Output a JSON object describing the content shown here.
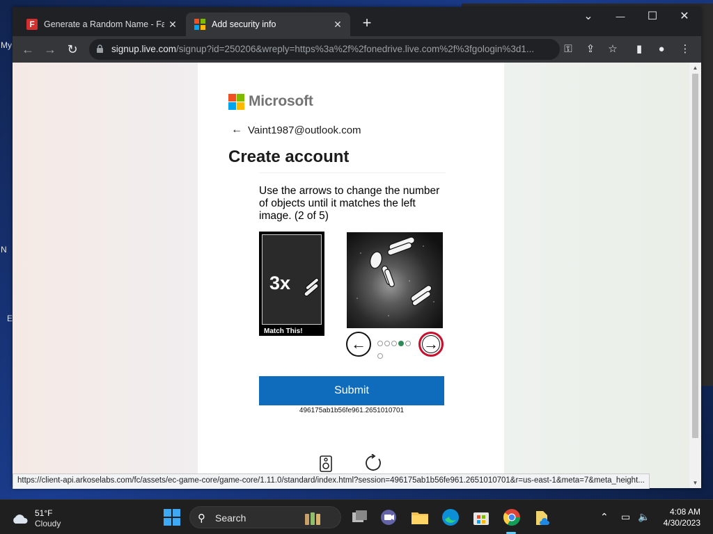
{
  "desktop": {
    "fragments": [
      "My",
      "N",
      "E"
    ]
  },
  "browser": {
    "tabs": [
      {
        "title": "Generate a Random Name - Fake",
        "close": "✕"
      },
      {
        "title": "Add security info",
        "close": "✕"
      }
    ],
    "new_tab": "+",
    "window_controls": {
      "chevron": "⌄",
      "minimize": "—",
      "maximize": "☐",
      "close": "✕"
    },
    "url_host": "signup.live.com",
    "url_rest": "/signup?id=250206&wreply=https%3a%2f%2fonedrive.live.com%2f%3fgologin%3d1...",
    "status_url": "https://client-api.arkoselabs.com/fc/assets/ec-game-core/game-core/1.11.0/standard/index.html?session=496175ab1b56fe961.2651010701&r=us-east-1&meta=7&meta_height..."
  },
  "page": {
    "brand": "Microsoft",
    "back_arrow": "←",
    "email": "Vaint1987@outlook.com",
    "heading": "Create account",
    "prompt": "Use the arrows to change the number of objects until it matches the left image. (2 of 5)",
    "match_count": "3x",
    "match_caption": "Match This!",
    "left_arrow": "←",
    "right_arrow": "→",
    "dots_total": 6,
    "dots_active_index": 3,
    "submit_label": "Submit",
    "session_id": "496175ab1b56fe961.2651010701"
  },
  "colors": {
    "ms_red": "#f25022",
    "ms_green": "#7fba00",
    "ms_blue": "#00a4ef",
    "ms_yellow": "#ffb900",
    "submit_blue": "#0f6cbd",
    "right_arrow_ring": "#c8102e"
  },
  "taskbar": {
    "temperature": "51°F",
    "condition": "Cloudy",
    "search_label": "Search",
    "time": "4:08 AM",
    "date": "4/30/2023"
  }
}
